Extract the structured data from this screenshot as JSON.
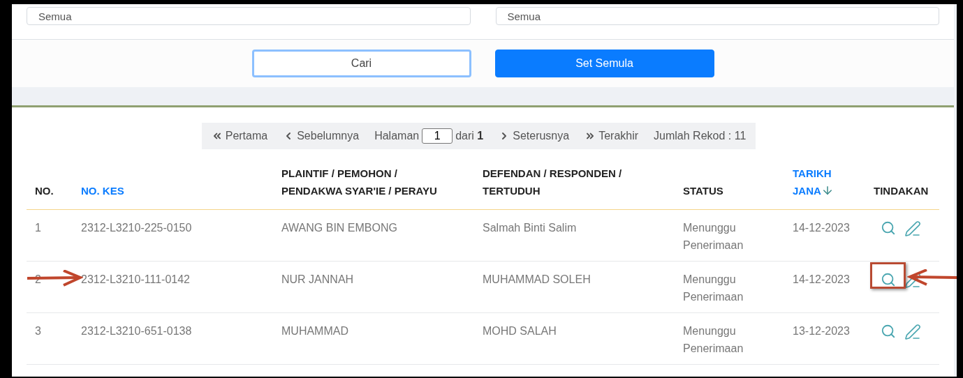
{
  "filters": [
    {
      "value": "Semua"
    },
    {
      "value": "Semua"
    }
  ],
  "buttons": [
    {
      "kind": "outline",
      "label": "Cari"
    },
    {
      "kind": "primary",
      "label": "Set Semula"
    }
  ],
  "pagination": {
    "first": "Pertama",
    "previous": "Sebelumnya",
    "page_label": "Halaman",
    "page": "1",
    "of_label": "dari",
    "total_pages": "1",
    "next": "Seterusnya",
    "last": "Terakhir",
    "record_count": "Jumlah Rekod : 11"
  },
  "table": {
    "columns": [
      {
        "label": "NO.",
        "sortable": false,
        "sorted": false
      },
      {
        "label": "NO. KES",
        "sortable": true,
        "sorted": false
      },
      {
        "label": "PLAINTIF / PEMOHON / PENDAKWA SYAR'IE / PERAYU",
        "sortable": false,
        "sorted": false
      },
      {
        "label": "DEFENDAN / RESPONDEN / TERTUDUH",
        "sortable": false,
        "sorted": false
      },
      {
        "label": "STATUS",
        "sortable": false,
        "sorted": false
      },
      {
        "label": "TARIKH JANA",
        "sortable": true,
        "sorted": true
      },
      {
        "label": "TINDAKAN",
        "sortable": false,
        "sorted": false
      }
    ],
    "rows": [
      {
        "no": "1",
        "case_no": "2312-L3210-225-0150",
        "plaintiff": "AWANG BIN EMBONG",
        "defendant": "Salmah Binti Salim",
        "status": "Menunggu Penerimaan",
        "date": "14-12-2023",
        "marked": false
      },
      {
        "no": "2",
        "case_no": "2312-L3210-111-0142",
        "plaintiff": "NUR JANNAH",
        "defendant": "MUHAMMAD SOLEH",
        "status": "Menunggu Penerimaan",
        "date": "14-12-2023",
        "marked": true
      },
      {
        "no": "3",
        "case_no": "2312-L3210-651-0138",
        "plaintiff": "MUHAMMAD",
        "defendant": "MOHD SALAH",
        "status": "Menunggu Penerimaan",
        "date": "13-12-2023",
        "marked": false
      }
    ]
  }
}
